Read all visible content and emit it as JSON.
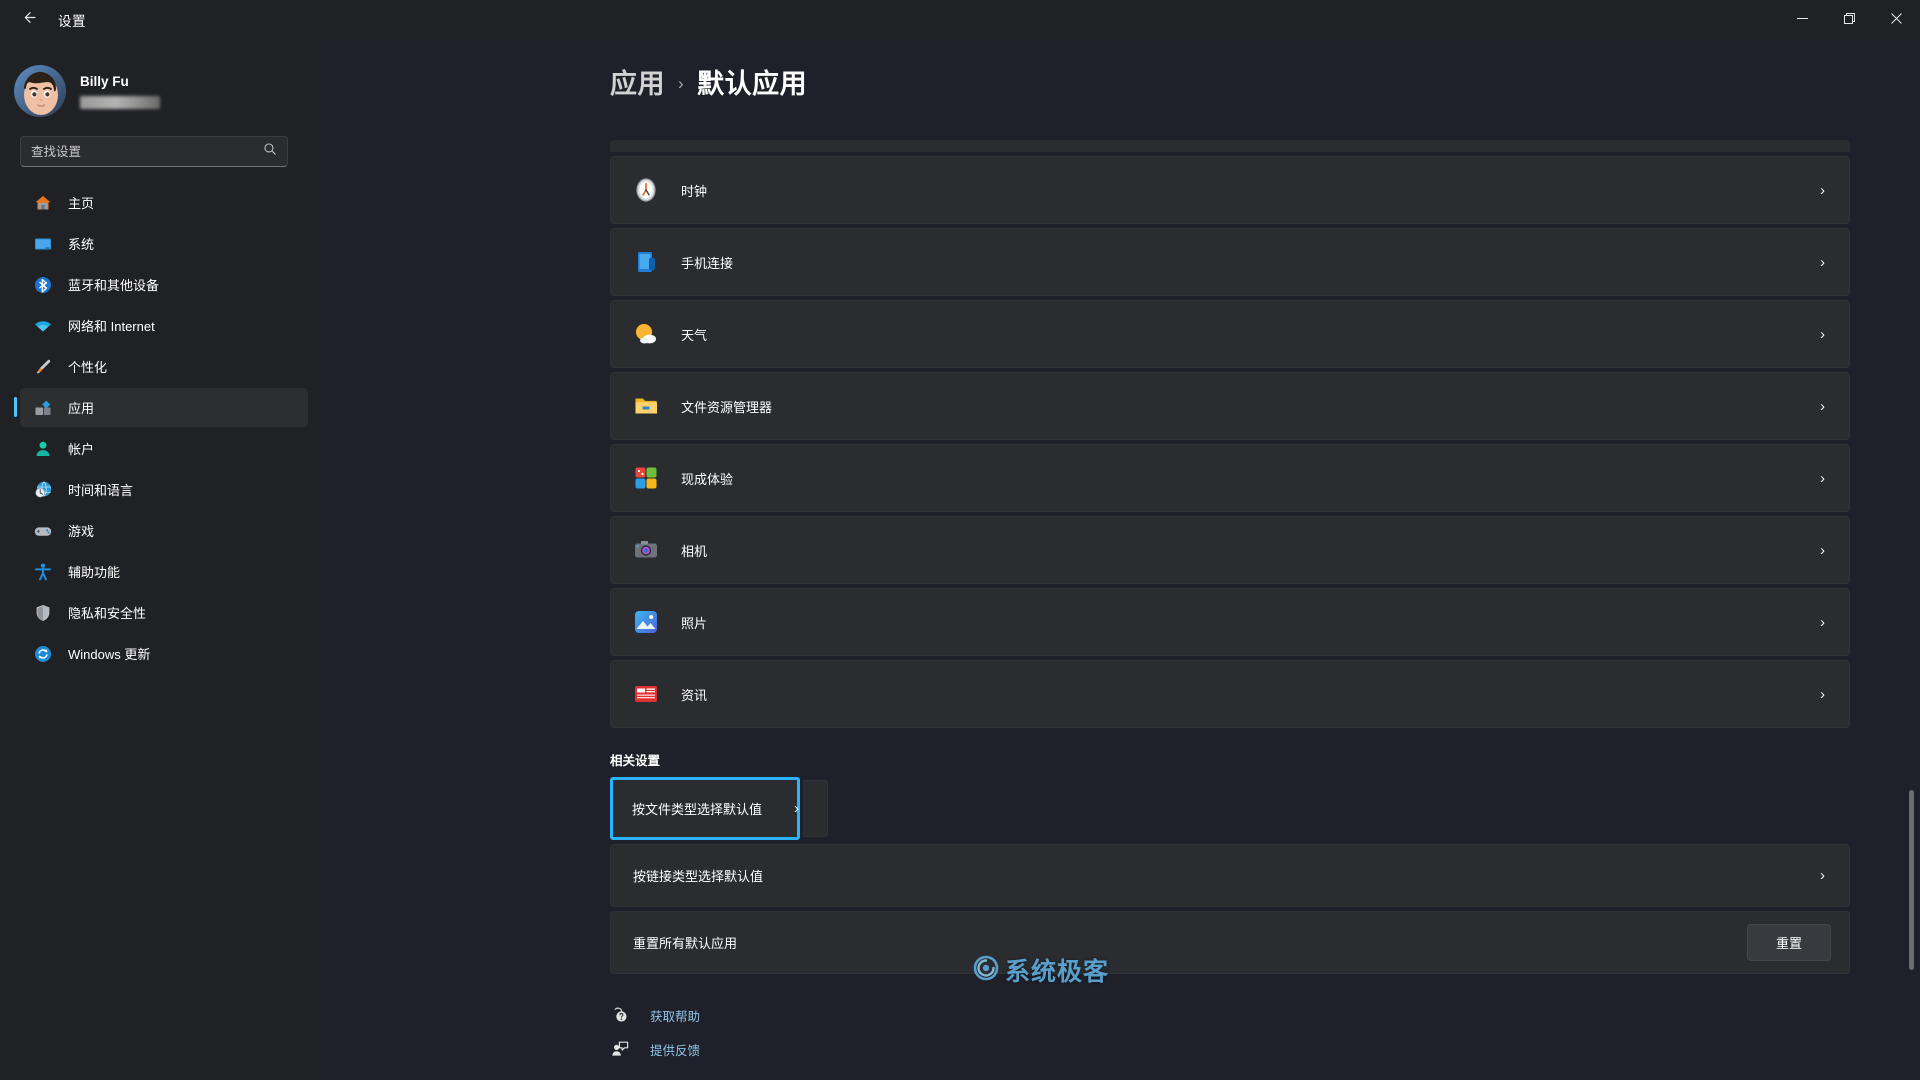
{
  "window": {
    "title": "设置",
    "back_icon": "back-arrow-icon",
    "controls": {
      "minimize": "–",
      "maximize": "❐",
      "close": "✕"
    }
  },
  "sidebar": {
    "profile": {
      "name": "Billy Fu",
      "email_redacted": true
    },
    "search": {
      "placeholder": "查找设置",
      "value": "",
      "icon": "search-icon"
    },
    "items": [
      {
        "label": "主页",
        "icon": "home-icon",
        "active": false
      },
      {
        "label": "系统",
        "icon": "system-display-icon",
        "active": false
      },
      {
        "label": "蓝牙和其他设备",
        "icon": "bluetooth-icon",
        "active": false
      },
      {
        "label": "网络和 Internet",
        "icon": "wifi-icon",
        "active": false
      },
      {
        "label": "个性化",
        "icon": "paintbrush-icon",
        "active": false
      },
      {
        "label": "应用",
        "icon": "apps-icon",
        "active": true
      },
      {
        "label": "帐户",
        "icon": "account-person-icon",
        "active": false
      },
      {
        "label": "时间和语言",
        "icon": "clock-globe-icon",
        "active": false
      },
      {
        "label": "游戏",
        "icon": "gamepad-icon",
        "active": false
      },
      {
        "label": "辅助功能",
        "icon": "accessibility-person-icon",
        "active": false
      },
      {
        "label": "隐私和安全性",
        "icon": "shield-icon",
        "active": false
      },
      {
        "label": "Windows 更新",
        "icon": "update-refresh-icon",
        "active": false
      }
    ]
  },
  "breadcrumb": {
    "parent": "应用",
    "separator": "›",
    "current": "默认应用"
  },
  "apps": [
    {
      "name": "时钟",
      "icon": "clock-app-icon",
      "chevron": "›"
    },
    {
      "name": "手机连接",
      "icon": "phone-link-icon",
      "chevron": "›"
    },
    {
      "name": "天气",
      "icon": "weather-icon",
      "chevron": "›"
    },
    {
      "name": "文件资源管理器",
      "icon": "file-explorer-icon",
      "chevron": "›"
    },
    {
      "name": "现成体验",
      "icon": "get-started-icon",
      "chevron": "›"
    },
    {
      "name": "相机",
      "icon": "camera-icon",
      "chevron": "›"
    },
    {
      "name": "照片",
      "icon": "photos-icon",
      "chevron": "›"
    },
    {
      "name": "资讯",
      "icon": "news-icon",
      "chevron": "›"
    }
  ],
  "related": {
    "title": "相关设置",
    "items": [
      {
        "label": "按文件类型选择默认值",
        "chevron": "›",
        "focused": true
      },
      {
        "label": "按链接类型选择默认值",
        "chevron": "›",
        "focused": false
      }
    ],
    "reset": {
      "label": "重置所有默认应用",
      "button": "重置"
    }
  },
  "footer": {
    "links": [
      {
        "label": "获取帮助",
        "icon": "help-question-icon"
      },
      {
        "label": "提供反馈",
        "icon": "feedback-icon"
      }
    ]
  },
  "watermark": {
    "text": "系统极客",
    "icon": "logo-swirl-icon"
  },
  "colors": {
    "accent": "#4cc2ff",
    "focus_border": "#2bb3ff",
    "card_bg": "#2b2c30",
    "sidebar_bg": "#202124",
    "page_bg": "#1f2029",
    "link": "#8fc5e8"
  }
}
